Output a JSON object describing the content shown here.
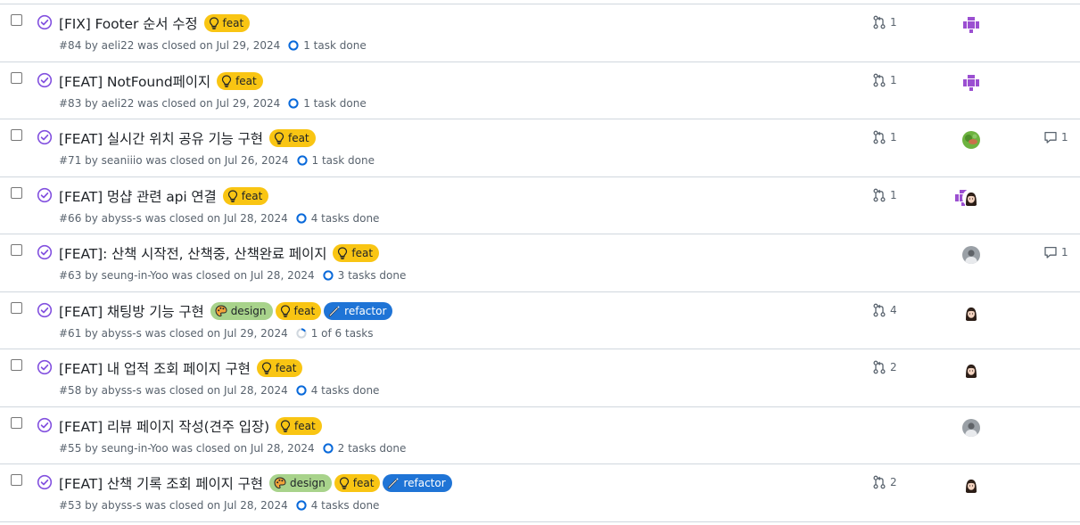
{
  "colors": {
    "closed_purple": "#8250df",
    "feat": "#f9c513",
    "design": "#a8d38b",
    "refactor": "#1f74d6",
    "muted": "#59636e",
    "border": "#d0d7de"
  },
  "issues": [
    {
      "title": "[FIX] Footer 순서 수정",
      "labels": [
        {
          "name": "feat",
          "type": "feat",
          "icon": "bulb-icon"
        }
      ],
      "meta": "#84 by aeli22 was closed on Jul 29, 2024",
      "tasks": "1 task done",
      "task_progress": 1.0,
      "pr_count": "1",
      "assignees": [
        "purple-pixel"
      ],
      "comments": ""
    },
    {
      "title": "[FEAT] NotFound페이지",
      "labels": [
        {
          "name": "feat",
          "type": "feat",
          "icon": "bulb-icon"
        }
      ],
      "meta": "#83 by aeli22 was closed on Jul 29, 2024",
      "tasks": "1 task done",
      "task_progress": 1.0,
      "pr_count": "1",
      "assignees": [
        "purple-pixel"
      ],
      "comments": ""
    },
    {
      "title": "[FEAT] 실시간 위치 공유 기능 구현",
      "labels": [
        {
          "name": "feat",
          "type": "feat",
          "icon": "bulb-icon"
        }
      ],
      "meta": "#71 by seaniiio was closed on Jul 26, 2024",
      "tasks": "1 task done",
      "task_progress": 1.0,
      "pr_count": "1",
      "assignees": [
        "green-photo"
      ],
      "comments": "1"
    },
    {
      "title": "[FEAT] 멍샵 관련 api 연결",
      "labels": [
        {
          "name": "feat",
          "type": "feat",
          "icon": "bulb-icon"
        }
      ],
      "meta": "#66 by abyss-s was closed on Jul 28, 2024",
      "tasks": "4 tasks done",
      "task_progress": 1.0,
      "pr_count": "1",
      "assignees": [
        "purple-pixel",
        "girl-face"
      ],
      "comments": ""
    },
    {
      "title": "[FEAT]: 산책 시작전, 산책중, 산책완료 페이지",
      "labels": [
        {
          "name": "feat",
          "type": "feat",
          "icon": "bulb-icon"
        }
      ],
      "meta": "#63 by seung-in-Yoo was closed on Jul 28, 2024",
      "tasks": "3 tasks done",
      "task_progress": 1.0,
      "pr_count": "",
      "assignees": [
        "gray-photo"
      ],
      "comments": "1"
    },
    {
      "title": "[FEAT] 채팅방 기능 구현",
      "labels": [
        {
          "name": "design",
          "type": "design",
          "icon": "palette-icon"
        },
        {
          "name": "feat",
          "type": "feat",
          "icon": "bulb-icon"
        },
        {
          "name": "refactor",
          "type": "refactor",
          "icon": "wand-icon"
        }
      ],
      "meta": "#61 by abyss-s was closed on Jul 29, 2024",
      "tasks": "1 of 6 tasks",
      "task_progress": 0.1667,
      "pr_count": "4",
      "assignees": [
        "girl-face"
      ],
      "comments": ""
    },
    {
      "title": "[FEAT] 내 업적 조회 페이지 구현",
      "labels": [
        {
          "name": "feat",
          "type": "feat",
          "icon": "bulb-icon"
        }
      ],
      "meta": "#58 by abyss-s was closed on Jul 28, 2024",
      "tasks": "4 tasks done",
      "task_progress": 1.0,
      "pr_count": "2",
      "assignees": [
        "girl-face"
      ],
      "comments": ""
    },
    {
      "title": "[FEAT] 리뷰 페이지 작성(견주 입장)",
      "labels": [
        {
          "name": "feat",
          "type": "feat",
          "icon": "bulb-icon"
        }
      ],
      "meta": "#55 by seung-in-Yoo was closed on Jul 28, 2024",
      "tasks": "2 tasks done",
      "task_progress": 1.0,
      "pr_count": "",
      "assignees": [
        "gray-photo"
      ],
      "comments": ""
    },
    {
      "title": "[FEAT] 산책 기록 조회 페이지 구현",
      "labels": [
        {
          "name": "design",
          "type": "design",
          "icon": "palette-icon"
        },
        {
          "name": "feat",
          "type": "feat",
          "icon": "bulb-icon"
        },
        {
          "name": "refactor",
          "type": "refactor",
          "icon": "wand-icon"
        }
      ],
      "meta": "#53 by abyss-s was closed on Jul 28, 2024",
      "tasks": "4 tasks done",
      "task_progress": 1.0,
      "pr_count": "2",
      "assignees": [
        "girl-face"
      ],
      "comments": ""
    }
  ]
}
